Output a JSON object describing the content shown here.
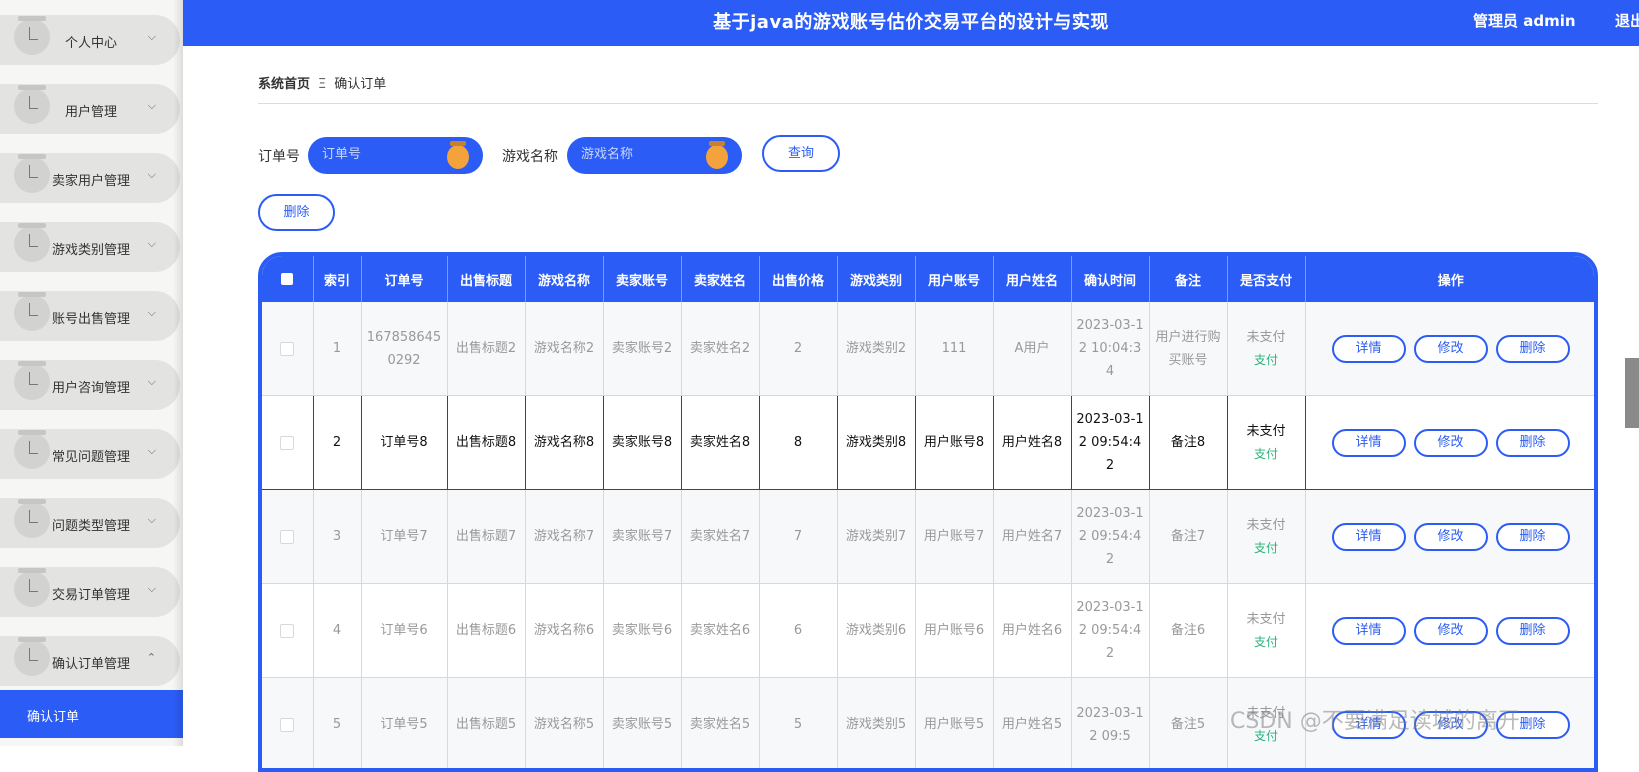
{
  "header": {
    "title": "基于java的游戏账号估价交易平台的设计与实现",
    "user": "管理员 admin",
    "logout": "退出登录"
  },
  "sidebar": {
    "items": [
      {
        "label": "个人中心",
        "icon": "clock-icon"
      },
      {
        "label": "用户管理",
        "icon": "clock-icon"
      },
      {
        "label": "卖家用户管理",
        "icon": "clock-icon"
      },
      {
        "label": "游戏类别管理",
        "icon": "clock-icon"
      },
      {
        "label": "账号出售管理",
        "icon": "clock-icon"
      },
      {
        "label": "用户咨询管理",
        "icon": "clock-icon"
      },
      {
        "label": "常见问题管理",
        "icon": "clock-icon"
      },
      {
        "label": "问题类型管理",
        "icon": "clock-icon"
      },
      {
        "label": "交易订单管理",
        "icon": "clock-icon"
      },
      {
        "label": "确认订单管理",
        "icon": "clock-icon",
        "expanded": true
      }
    ],
    "active_sub": "确认订单"
  },
  "breadcrumb": {
    "home": "系统首页",
    "separator": "Ξ",
    "current": "确认订单"
  },
  "search": {
    "order_label": "订单号",
    "order_placeholder": "订单号",
    "game_label": "游戏名称",
    "game_placeholder": "游戏名称",
    "query_button": "查询",
    "delete_button": "删除"
  },
  "table": {
    "columns": [
      "索引",
      "订单号",
      "出售标题",
      "游戏名称",
      "卖家账号",
      "卖家姓名",
      "出售价格",
      "游戏类别",
      "用户账号",
      "用户姓名",
      "确认时间",
      "备注",
      "是否支付",
      "操作"
    ],
    "rows": [
      {
        "index": "1",
        "order": "1678586450292",
        "title": "出售标题2",
        "game": "游戏名称2",
        "seller_acc": "卖家账号2",
        "seller_name": "卖家姓名2",
        "price": "2",
        "category": "游戏类别2",
        "user_acc": "111",
        "user_name": "A用户",
        "time": "2023-03-12 10:04:34",
        "note": "用户进行购买账号",
        "paid": "未支付",
        "pay": "支付"
      },
      {
        "index": "2",
        "order": "订单号8",
        "title": "出售标题8",
        "game": "游戏名称8",
        "seller_acc": "卖家账号8",
        "seller_name": "卖家姓名8",
        "price": "8",
        "category": "游戏类别8",
        "user_acc": "用户账号8",
        "user_name": "用户姓名8",
        "time": "2023-03-12 09:54:42",
        "note": "备注8",
        "paid": "未支付",
        "pay": "支付"
      },
      {
        "index": "3",
        "order": "订单号7",
        "title": "出售标题7",
        "game": "游戏名称7",
        "seller_acc": "卖家账号7",
        "seller_name": "卖家姓名7",
        "price": "7",
        "category": "游戏类别7",
        "user_acc": "用户账号7",
        "user_name": "用户姓名7",
        "time": "2023-03-12 09:54:42",
        "note": "备注7",
        "paid": "未支付",
        "pay": "支付"
      },
      {
        "index": "4",
        "order": "订单号6",
        "title": "出售标题6",
        "game": "游戏名称6",
        "seller_acc": "卖家账号6",
        "seller_name": "卖家姓名6",
        "price": "6",
        "category": "游戏类别6",
        "user_acc": "用户账号6",
        "user_name": "用户姓名6",
        "time": "2023-03-12 09:54:42",
        "note": "备注6",
        "paid": "未支付",
        "pay": "支付"
      },
      {
        "index": "5",
        "order": "订单号5",
        "title": "出售标题5",
        "game": "游戏名称5",
        "seller_acc": "卖家账号5",
        "seller_name": "卖家姓名5",
        "price": "5",
        "category": "游戏类别5",
        "user_acc": "用户账号5",
        "user_name": "用户姓名5",
        "time": "2023-03-12 09:5",
        "note": "备注5",
        "paid": "未支付",
        "pay": "支付"
      }
    ],
    "actions": {
      "detail": "详情",
      "edit": "修改",
      "delete": "删除"
    }
  },
  "watermark": "CSDN @不要满足读城的离开",
  "colors": {
    "primary": "#2b5cf5",
    "pay": "#2ab27b",
    "knob": "#f4a23b"
  }
}
